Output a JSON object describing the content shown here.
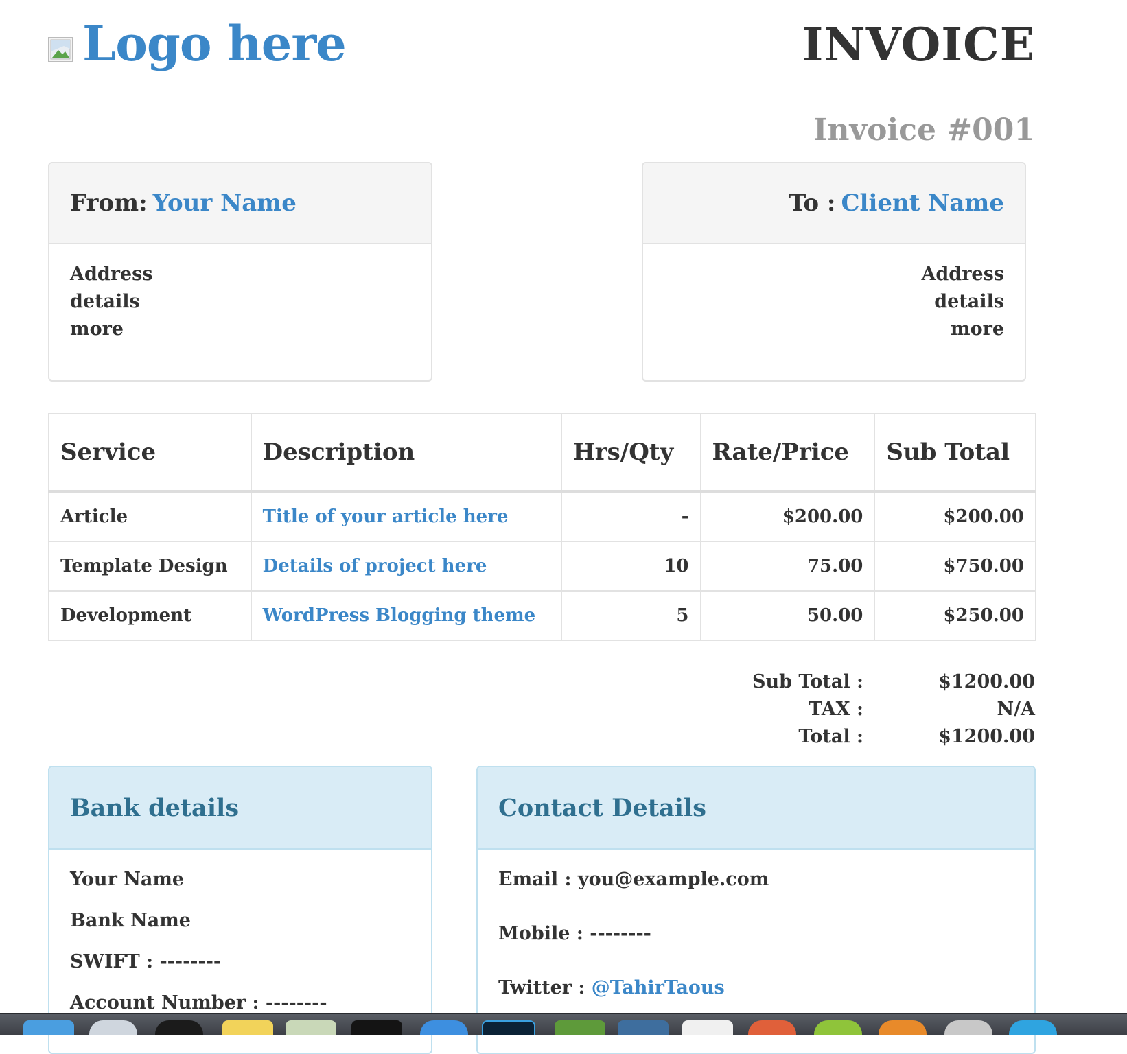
{
  "header": {
    "logo_text": "Logo here",
    "title": "INVOICE",
    "invoice_number": "Invoice #001"
  },
  "from": {
    "label": "From:",
    "name": "Your Name",
    "address": [
      "Address",
      "details",
      "more"
    ]
  },
  "to": {
    "label": "To :",
    "name": "Client Name",
    "address": [
      "Address",
      "details",
      "more"
    ]
  },
  "items": {
    "columns": [
      "Service",
      "Description",
      "Hrs/Qty",
      "Rate/Price",
      "Sub Total"
    ],
    "rows": [
      {
        "service": "Article",
        "description": "Title of your article here",
        "qty": "-",
        "rate": "$200.00",
        "subtotal": "$200.00"
      },
      {
        "service": "Template Design",
        "description": "Details of project here",
        "qty": "10",
        "rate": "75.00",
        "subtotal": "$750.00"
      },
      {
        "service": "Development",
        "description": "WordPress Blogging theme",
        "qty": "5",
        "rate": "50.00",
        "subtotal": "$250.00"
      }
    ]
  },
  "totals": {
    "subtotal_label": "Sub Total :",
    "subtotal_value": "$1200.00",
    "tax_label": "TAX :",
    "tax_value": "N/A",
    "total_label": "Total :",
    "total_value": "$1200.00"
  },
  "bank": {
    "title": "Bank details",
    "lines": [
      "Your Name",
      "Bank Name",
      "SWIFT : --------",
      "Account Number : --------"
    ]
  },
  "contact": {
    "title": "Contact Details",
    "email": "Email : you@example.com",
    "mobile": "Mobile : --------",
    "twitter_label": "Twitter : ",
    "twitter_handle": "@TahirTaous"
  },
  "colors": {
    "accent": "#3b87c8",
    "text": "#333333",
    "muted": "#999999",
    "info_header_bg": "#d9ecf6",
    "info_title": "#2f6f8f"
  },
  "icons": [
    "broken-image-icon"
  ]
}
